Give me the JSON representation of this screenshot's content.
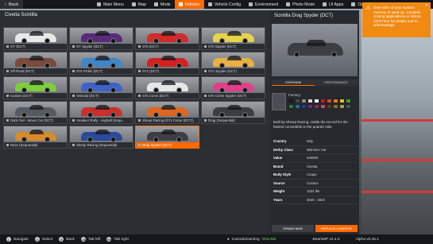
{
  "topbar": {
    "back_label": "Back",
    "menu": [
      {
        "label": "Main Menu",
        "active": false
      },
      {
        "label": "Map",
        "active": false
      },
      {
        "label": "Mods",
        "active": false
      },
      {
        "label": "Vehicles",
        "active": true
      },
      {
        "label": "Vehicle Config",
        "active": false
      },
      {
        "label": "Environment",
        "active": false
      },
      {
        "label": "Photo Mode",
        "active": false
      },
      {
        "label": "UI Apps",
        "active": false
      },
      {
        "label": "Options",
        "active": false
      }
    ]
  },
  "main": {
    "title": "Civetta Scintilla",
    "cards": [
      {
        "label": "GT (DCT)",
        "color": "#e8e8e8"
      },
      {
        "label": "GT Spyder (DCT)",
        "color": "#5a2a7a"
      },
      {
        "label": "GTs (DCT)",
        "color": "#d42a2a"
      },
      {
        "label": "GTs Spyder (DCT)",
        "color": "#e8d24a"
      },
      {
        "label": "Off-Road (DCT)",
        "color": "#7a4a3a"
      },
      {
        "label": "GTs Pickle (DCT)",
        "color": "#3f86c9"
      },
      {
        "label": "GTx (DCT)",
        "color": "#d62020"
      },
      {
        "label": "GTx Spyder (DCT)",
        "color": "#e8b040"
      },
      {
        "label": "Custom (DCT)",
        "color": "#7ccf3a"
      },
      {
        "label": "Velocita (DCT)",
        "color": "#3f62c9"
      },
      {
        "label": "GTs Corse (DCT)",
        "color": "#e6e6e6"
      },
      {
        "label": "GTs Corse Spyder (DCT)",
        "color": "#e0408a"
      },
      {
        "label": "Dark Owl - Movie Car (DCT)",
        "color": "#555a60"
      },
      {
        "label": "Amateur Rally - Asphalt (Sequ...",
        "color": "#c9302a"
      },
      {
        "label": "Sheep Racing (GTx Corse (DCT))",
        "color": "#e0661e"
      },
      {
        "label": "Drag (Sequential)",
        "color": "#3a3d42"
      },
      {
        "label": "Race (Sequential)",
        "color": "#d88a2a"
      },
      {
        "label": "Sheep Racing (Sequential)",
        "color": "#2a4a9a"
      },
      {
        "label": "Drag Spyder (DCT)",
        "color": "#3b3e43"
      }
    ],
    "selected_index": 18
  },
  "detail": {
    "title": "Scintilla Drag Spyder (DCT)",
    "tabs": [
      {
        "label": "OVERVIEW",
        "active": true
      },
      {
        "label": "PERFORMANCE",
        "active": false
      }
    ],
    "factory_label": "Factory:",
    "swatches": [
      "#1a1a1a",
      "#4a4a4a",
      "#8a8a8a",
      "#d8d8d8",
      "#ffffff",
      "#b22222",
      "#d24a2a",
      "#e07a1a",
      "#e0c020",
      "#4a9a2a",
      "#2a7a4a",
      "#2a6a9a",
      "#2a3a8a",
      "#6a2a8a",
      "#8a2a5a",
      "#c04a7a",
      "#5a3a2a",
      "#8a6a3a",
      "#a0a050",
      "#3a5a5a"
    ],
    "description": "Built by Sheep Racing, Holds the record for the fastest convertible in the quarter mile.",
    "specs": [
      {
        "key": "Country",
        "value": "Italy"
      },
      {
        "key": "Derby Class",
        "value": "Mid-Size Car"
      },
      {
        "key": "Value",
        "value": "545000"
      },
      {
        "key": "Brand",
        "value": "Civetta"
      },
      {
        "key": "Body Style",
        "value": "Coupe"
      },
      {
        "key": "Source",
        "value": "Custom"
      },
      {
        "key": "Weight",
        "value": "1022 lbs"
      },
      {
        "key": "Years",
        "value": "2020 - 2022"
      }
    ],
    "buttons": {
      "spawn": "SPAWN NEW",
      "replace": "REPLACE CURRENT"
    }
  },
  "notice": {
    "text": "Over 60% of your system memory is used up. Consider closing applications or reboot. Click here for details and to acknowledge"
  },
  "bottombar": {
    "hints": [
      {
        "glyph": "L",
        "label": "Navigate"
      },
      {
        "glyph": "A",
        "label": "Select"
      },
      {
        "glyph": "B",
        "label": "Back"
      },
      {
        "glyph": "LB",
        "label": "Tab left"
      },
      {
        "glyph": "RB",
        "label": "Tab right"
      }
    ],
    "username": "CamodoGaming",
    "status": "ONLINE",
    "beammp_version": "BeamMP v4.4.0",
    "alpha_version": "Alpha v0.25.1"
  }
}
